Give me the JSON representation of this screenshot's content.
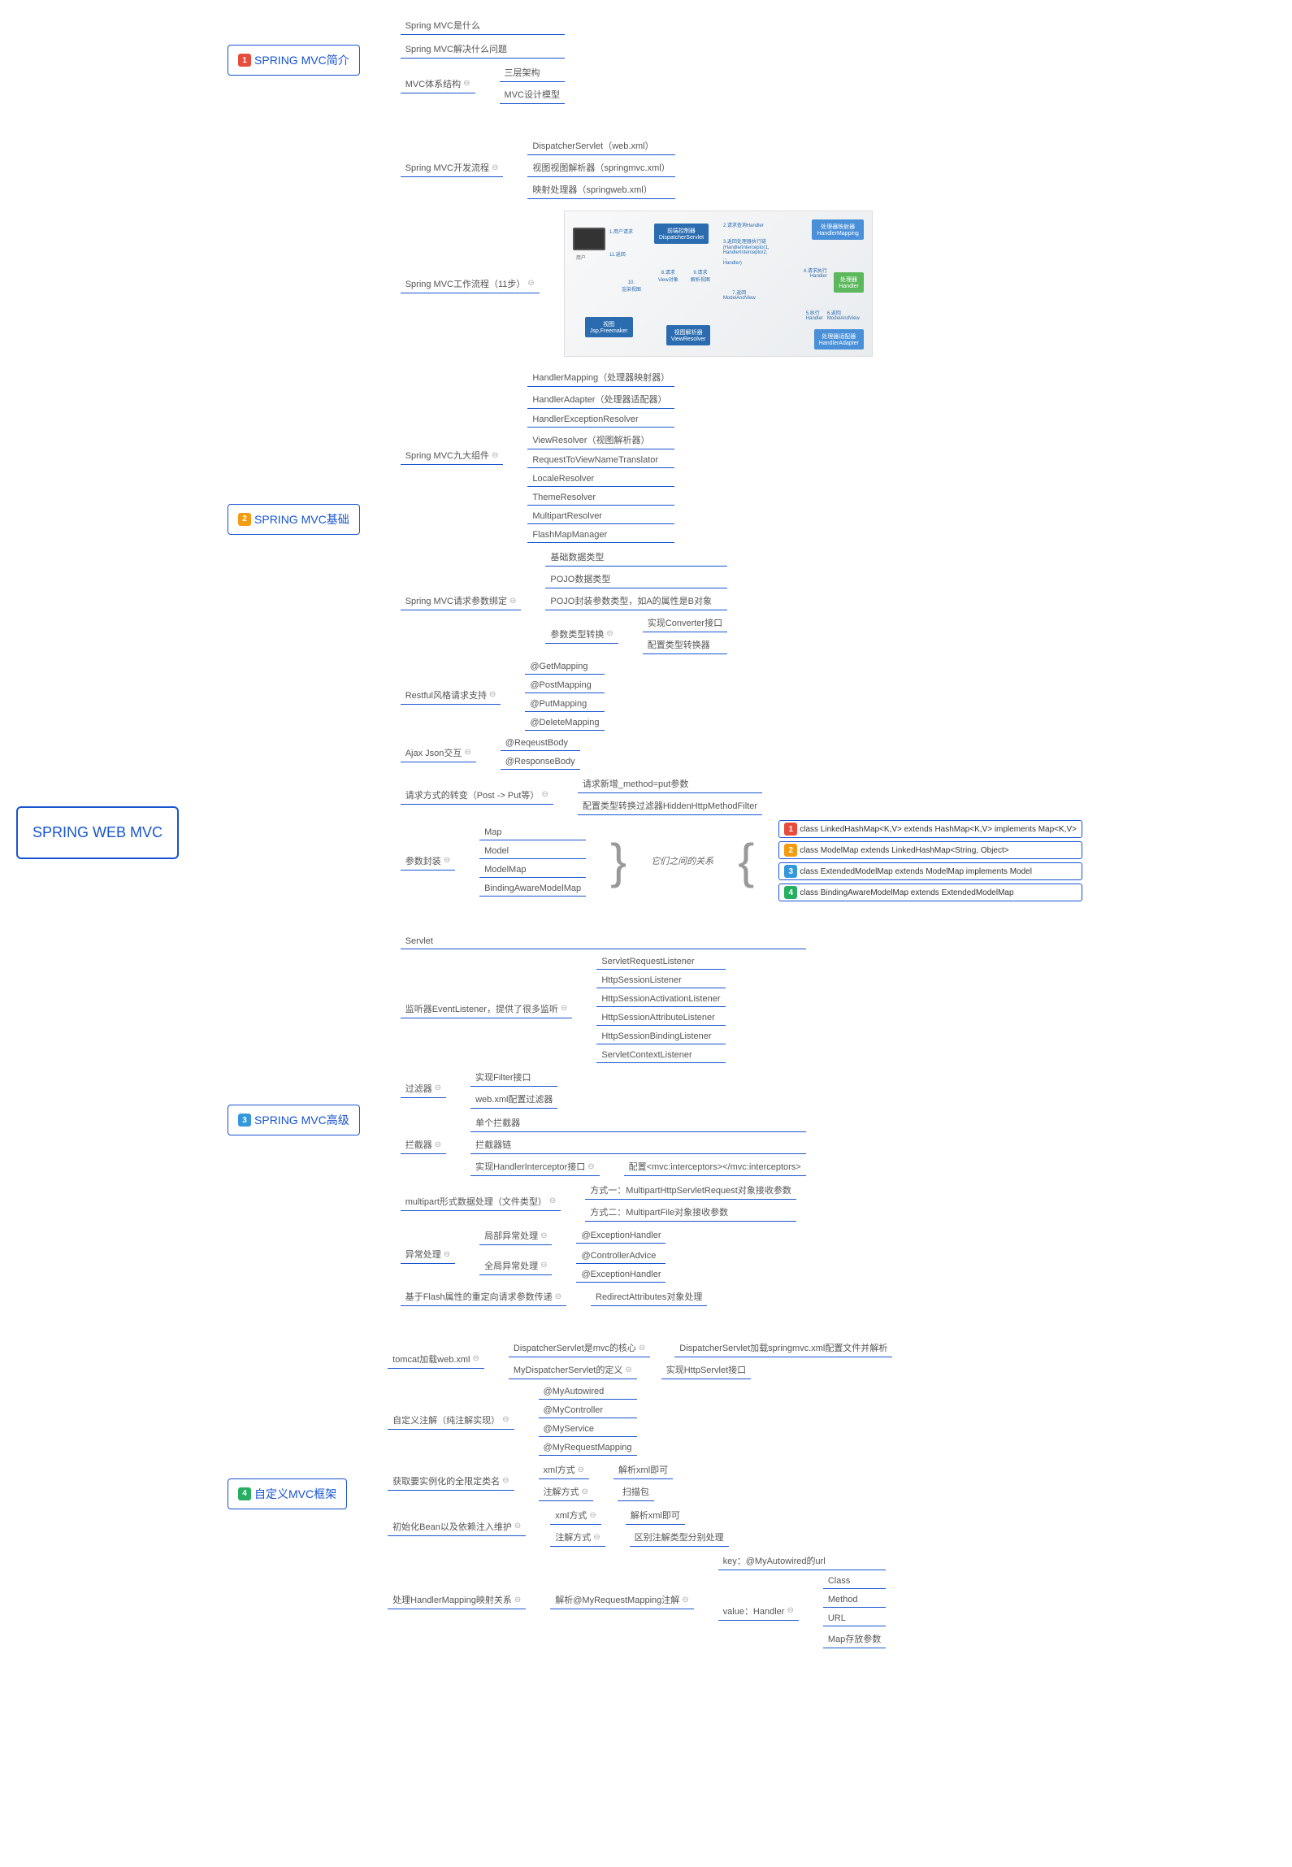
{
  "root": "SPRING WEB MVC",
  "b1": {
    "title": "SPRING MVC简介",
    "c1": "Spring MVC是什么",
    "c2": "Spring MVC解决什么问题",
    "c3": "MVC体系结构",
    "c3a": "三层架构",
    "c3b": "MVC设计模型"
  },
  "b2": {
    "title": "SPRING MVC基础",
    "dev": "Spring MVC开发流程",
    "dev1": "DispatcherServlet（web.xml）",
    "dev2": "视图视图解析器（springmvc.xml）",
    "dev3": "映射处理器（springweb.xml）",
    "flow": "Spring MVC工作流程（11步）",
    "nine": "Spring MVC九大组件",
    "n1": "HandlerMapping（处理器映射器）",
    "n2": "HandlerAdapter（处理器适配器）",
    "n3": "HandlerExceptionResolver",
    "n4": "ViewResolver（视图解析器）",
    "n5": "RequestToViewNameTranslator",
    "n6": "LocaleResolver",
    "n7": "ThemeResolver",
    "n8": "MultipartResolver",
    "n9": "FlashMapManager",
    "param": "Spring MVC请求参数绑定",
    "p1": "基础数据类型",
    "p2": "POJO数据类型",
    "p3": "POJO封装参数类型，如A的属性是B对象",
    "p4": "参数类型转换",
    "p4a": "实现Converter接口",
    "p4b": "配置类型转换器",
    "rest": "Restful风格请求支持",
    "r1": "@GetMapping",
    "r2": "@PostMapping",
    "r3": "@PutMapping",
    "r4": "@DeleteMapping",
    "ajax": "Ajax Json交互",
    "a1": "@ReqeustBody",
    "a2": "@ResponseBody",
    "method": "请求方式的转变（Post -> Put等）",
    "m1": "请求新增_method=put参数",
    "m2": "配置类型转换过滤器HiddenHttpMethodFilter",
    "wrap": "参数封装",
    "w1": "Map",
    "w2": "Model",
    "w3": "ModelMap",
    "w4": "BindingAwareModelMap",
    "wnote": "它们之间的关系",
    "wc1": "class LinkedHashMap<K,V> extends HashMap<K,V> implements Map<K,V>",
    "wc2": "class ModelMap extends LinkedHashMap<String, Object>",
    "wc3": "class ExtendedModelMap extends ModelMap implements Model",
    "wc4": "class BindingAwareModelMap extends ExtendedModelMap"
  },
  "b3": {
    "title": "SPRING MVC高级",
    "servlet": "Servlet",
    "listener": "监听器EventListener，提供了很多监听",
    "l1": "ServletRequestListener",
    "l2": "HttpSessionListener",
    "l3": "HttpSessionActivationListener",
    "l4": "HttpSessionAttributeListener",
    "l5": "HttpSessionBindingListener",
    "l6": "ServletContextListener",
    "filter": "过滤器",
    "f1": "实现Filter接口",
    "f2": "web.xml配置过滤器",
    "intercept": "拦截器",
    "i1": "单个拦截器",
    "i2": "拦截器链",
    "i3": "实现HandlerInterceptor接口",
    "i3a": "配置<mvc:interceptors></mvc:interceptors>",
    "multi": "multipart形式数据处理（文件类型）",
    "mu1": "方式一：MultipartHttpServletRequest对象接收参数",
    "mu2": "方式二：MultipartFile对象接收参数",
    "exc": "异常处理",
    "e1": "局部异常处理",
    "e1a": "@ExceptionHandler",
    "e2": "全局异常处理",
    "e2a": "@ControllerAdvice",
    "e2b": "@ExceptionHandler",
    "flash": "基于Flash属性的重定向请求参数传递",
    "flash1": "RedirectAttributes对象处理"
  },
  "b4": {
    "title": "自定义MVC框架",
    "tomcat": "tomcat加载web.xml",
    "t1": "DispatcherServlet是mvc的核心",
    "t1a": "DispatcherServlet加载springmvc.xml配置文件并解析",
    "t2": "MyDispatcherServlet的定义",
    "t2a": "实现HttpServlet接口",
    "anno": "自定义注解（纯注解实现）",
    "an1": "@MyAutowired",
    "an2": "@MyController",
    "an3": "@MyService",
    "an4": "@MyRequestMapping",
    "cls": "获取要实例化的全限定类名",
    "c1": "xml方式",
    "c1a": "解析xml即可",
    "c2": "注解方式",
    "c2a": "扫描包",
    "init": "初始化Bean以及依赖注入维护",
    "in1": "xml方式",
    "in1a": "解析xml即可",
    "in2": "注解方式",
    "in2a": "区别注解类型分别处理",
    "map": "处理HandlerMapping映射关系",
    "mp1": "解析@MyRequestMapping注解",
    "mp2": "key：@MyAutowired的url",
    "mp3": "value：Handler",
    "mp3a": "Class",
    "mp3b": "Method",
    "mp3c": "URL",
    "mp3d": "Map存放参数"
  },
  "diag": {
    "d1": "前端控制器",
    "d1s": "DispatcherServlet",
    "d2": "处理器映射器",
    "d2s": "HandlerMapping",
    "d3": "处理器",
    "d3s": "Handler",
    "d4": "处理器适配器",
    "d4s": "HandlerAdapter",
    "d5": "视图解析器",
    "d5s": "ViewResolver",
    "d6": "视图",
    "d6s": "Jsp,Freemaker",
    "s1": "1.用户请求",
    "s2": "2.请求查询Handler",
    "s3": "3.返回处理器执行链",
    "s3a": "(HandlerInterceptor1,",
    "s3b": "HandlerInterceptor2,",
    "s3c": "...",
    "s3d": "Handler)",
    "s4": "4.请求执行",
    "s4a": "Handler",
    "s5": "5.执行",
    "s5a": "Handler",
    "s6": "6.返回",
    "s6a": "ModelAndView",
    "s7": "7.返回",
    "s7a": "ModelAndView",
    "s8": "8.请求",
    "s8a": "View对象",
    "s9": "9.请求",
    "s9a": "解析视图",
    "s10": "10.",
    "s10a": "渲染视图",
    "s11": "11.返回"
  }
}
